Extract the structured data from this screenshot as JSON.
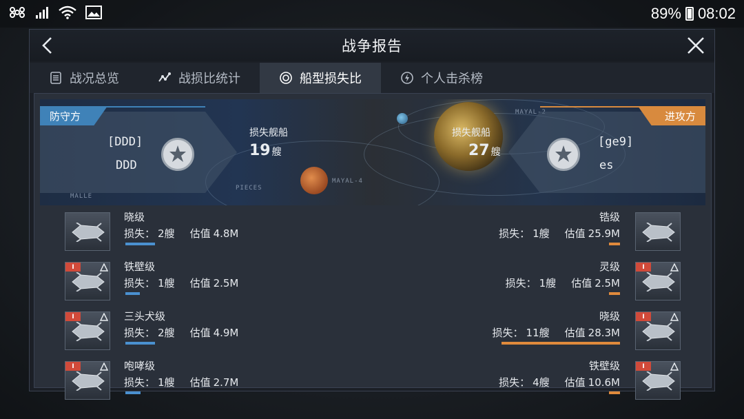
{
  "status": {
    "battery_pct": "89%",
    "time": "08:02"
  },
  "header": {
    "title": "战争报告"
  },
  "tabs": [
    {
      "label": "战况总览",
      "icon": "report-icon"
    },
    {
      "label": "战损比统计",
      "icon": "trend-icon"
    },
    {
      "label": "船型损失比",
      "icon": "target-icon",
      "active": true
    },
    {
      "label": "个人击杀榜",
      "icon": "lightning-icon"
    }
  ],
  "defender": {
    "side_label": "防守方",
    "tag": "[DDD]",
    "name": "DDD",
    "loss_label": "损失舰船",
    "loss_count": "19",
    "loss_unit": "艘"
  },
  "attacker": {
    "side_label": "进攻方",
    "tag": "[ge9]",
    "name": "es",
    "loss_label": "损失舰船",
    "loss_count": "27",
    "loss_unit": "艘"
  },
  "map_labels": [
    "MAYAL-4",
    "MAYAL-2",
    "PIECES",
    "MALLE"
  ],
  "loss_label": "损失：",
  "value_label": "估值",
  "left_ships": [
    {
      "name": "晓级",
      "loss": "2艘",
      "value": "4.8M",
      "bar_fraction": 0.27,
      "badge": false
    },
    {
      "name": "铁壁级",
      "loss": "1艘",
      "value": "2.5M",
      "bar_fraction": 0.13,
      "badge": true
    },
    {
      "name": "三头犬级",
      "loss": "2艘",
      "value": "4.9M",
      "bar_fraction": 0.27,
      "badge": true
    },
    {
      "name": "咆哮级",
      "loss": "1艘",
      "value": "2.7M",
      "bar_fraction": 0.14,
      "badge": true
    }
  ],
  "right_ships": [
    {
      "name": "锆级",
      "loss": "1艘",
      "value": "25.9M",
      "bar_fraction": 0.05,
      "badge": false
    },
    {
      "name": "灵级",
      "loss": "1艘",
      "value": "2.5M",
      "bar_fraction": 0.05,
      "badge": true
    },
    {
      "name": "晓级",
      "loss": "11艘",
      "value": "28.3M",
      "bar_fraction": 0.55,
      "badge": true
    },
    {
      "name": "铁壁级",
      "loss": "4艘",
      "value": "10.6M",
      "bar_fraction": 0.05,
      "badge": true
    }
  ],
  "colors": {
    "defender": "#3f82b8",
    "attacker": "#d88a3e",
    "badge": "#d14a3a"
  }
}
